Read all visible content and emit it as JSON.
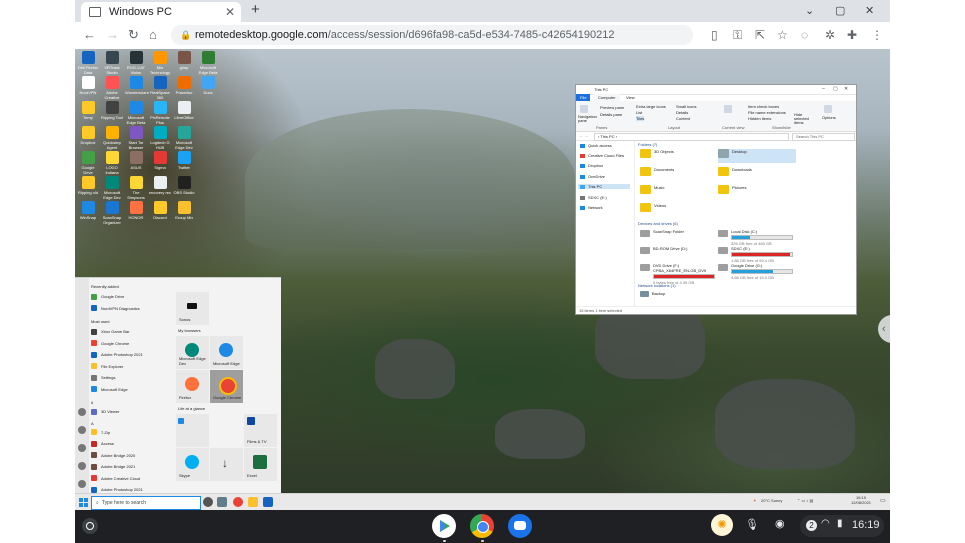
{
  "browser": {
    "tab_title": "Windows PC",
    "tab_close": "✕",
    "new_tab": "+",
    "window_controls": [
      "⌄",
      "▢",
      "✕"
    ],
    "url_host": "remotedesktop.google.com",
    "url_path": "/access/session/d696fa98-ca5d-e534-7485-c42654190212",
    "nav": {
      "back": "←",
      "forward": "→",
      "reload": "↻",
      "home": "⌂"
    },
    "right_icons": [
      "▯",
      "⚿",
      "⇱",
      "☆",
      "◌",
      "✲",
      "✚",
      "⋮"
    ]
  },
  "desktop_icons": [
    {
      "label": "Dell Firefox Data",
      "color": "#1565c0"
    },
    {
      "label": "VRTrack Studio",
      "color": "#37474f"
    },
    {
      "label": "ROG-CAT Vision",
      "color": "#263238"
    },
    {
      "label": "Mio Technology",
      "color": "#ff9800"
    },
    {
      "label": "gimp",
      "color": "#795548"
    },
    {
      "label": "Microsoft Edge Beta",
      "color": "#2e7d32"
    },
    {
      "label": "NordVPN",
      "color": "#ffffff"
    },
    {
      "label": "Adobe Creative Cloud",
      "color": "#ff5252"
    },
    {
      "label": "Wondershare",
      "color": "#1e88e5"
    },
    {
      "label": "RealSpace 360",
      "color": "#1565c0"
    },
    {
      "label": "PowerIso",
      "color": "#ef6c00"
    },
    {
      "label": "Docs",
      "color": "#42a5f5"
    },
    {
      "label": "Temp",
      "color": "#ffca28"
    },
    {
      "label": "Ripping Tool",
      "color": "#424242"
    },
    {
      "label": "Microsoft Edge Beta",
      "color": "#1e88e5"
    },
    {
      "label": "PixRemote Plus",
      "color": "#29b6f6"
    },
    {
      "label": "LibreOffice",
      "color": "#eceff1"
    },
    {
      "label": "",
      "color": "#000000"
    },
    {
      "label": "Dropbox",
      "color": "#ffca28"
    },
    {
      "label": "Quickstep Agent",
      "color": "#ffb300"
    },
    {
      "label": "Start Tor Browser",
      "color": "#7e57c2"
    },
    {
      "label": "Logitech G HUB",
      "color": "#00acc1"
    },
    {
      "label": "Microsoft Edge Dev",
      "color": "#26a69a"
    },
    {
      "label": "",
      "color": "#000000"
    },
    {
      "label": "Google Drive",
      "color": "#43a047"
    },
    {
      "label": "LOGO Indiana",
      "color": "#fdd835"
    },
    {
      "label": "ASUS",
      "color": "#8d6e63"
    },
    {
      "label": "Sigma",
      "color": "#e53935"
    },
    {
      "label": "Twitter",
      "color": "#1da1f2"
    },
    {
      "label": "",
      "color": "#000000"
    },
    {
      "label": "Ripping old",
      "color": "#ffca28"
    },
    {
      "label": "Microsoft Edge Dev",
      "color": "#00897b"
    },
    {
      "label": "The Simpsons",
      "color": "#fdd835"
    },
    {
      "label": "recovery rec",
      "color": "#eceff1"
    },
    {
      "label": "OBS Studio",
      "color": "#212121"
    },
    {
      "label": "",
      "color": "#000000"
    },
    {
      "label": "WinSnap",
      "color": "#1e88e5"
    },
    {
      "label": "ScanSnap Organizer",
      "color": "#1976d2"
    },
    {
      "label": "HONOR",
      "color": "#ff7043"
    },
    {
      "label": "Discord",
      "color": "#ffca28"
    },
    {
      "label": "Group Mix",
      "color": "#fbc02d"
    },
    {
      "label": "",
      "color": "#000000"
    }
  ],
  "start_menu": {
    "recently_added_label": "Recently added",
    "recent": [
      {
        "label": "Google Drive",
        "color": "#43a047"
      },
      {
        "label": "NordVPN Diagnostics",
        "color": "#1565c0"
      }
    ],
    "most_used_label": "Most used",
    "most_used": [
      {
        "label": "Xbox Game Bar",
        "color": "#424242"
      },
      {
        "label": "Google Chrome",
        "color": "#ea4335"
      },
      {
        "label": "Adobe Photoshop 2021",
        "color": "#1565c0"
      },
      {
        "label": "File Explorer",
        "color": "#fbc02d"
      },
      {
        "label": "Settings",
        "color": "#757575"
      },
      {
        "label": "Microsoft Edge",
        "color": "#1e88e5"
      }
    ],
    "letter_hash": "#",
    "hash_apps": [
      {
        "label": "3D Viewer",
        "color": "#5c6bc0"
      }
    ],
    "letter_a": "A",
    "a_apps": [
      {
        "label": "7-Zip",
        "color": "#fbc02d"
      },
      {
        "label": "Access",
        "color": "#c62828"
      },
      {
        "label": "Adobe Bridge 2020",
        "color": "#6d4c41"
      },
      {
        "label": "Adobe Bridge 2021",
        "color": "#6d4c41"
      },
      {
        "label": "Adobe Creative Cloud",
        "color": "#e53935"
      },
      {
        "label": "Adobe Photoshop 2021",
        "color": "#1565c0"
      }
    ],
    "tiles": {
      "sonos": "Sonos",
      "my_browsers": "My browsers",
      "edge_dev": "Microsoft Edge Dev",
      "edge": "Microsoft Edge",
      "firefox": "Firefox",
      "chrome": "Google Chrome",
      "life_at_a_glance": "Life at a glance",
      "films_tv": "Films & TV",
      "skype": "Skype",
      "excel": "Excel"
    }
  },
  "explorer": {
    "title": "This PC",
    "tabs": [
      "File",
      "Computer",
      "View"
    ],
    "ribbon": {
      "navigation_pane": "Navigation pane",
      "preview_pane": "Preview pane",
      "details_pane": "Details pane",
      "extra_large_icons": "Extra large icons",
      "large_icons": "Large icons",
      "small_icons": "Small icons",
      "list": "List",
      "details": "Details",
      "tiles": "Tiles",
      "content": "Content",
      "item_check_boxes": "Item check boxes",
      "file_name_extensions": "File name extensions",
      "hidden_items": "Hidden items",
      "hide_selected": "Hide selected items",
      "options": "Options",
      "groups": [
        "Panes",
        "Layout",
        "Current view",
        "Show/hide"
      ]
    },
    "address": "›  This PC  ›",
    "search_placeholder": "Search This PC",
    "nav_items": [
      {
        "label": "Quick access",
        "color": "#1e88e5"
      },
      {
        "label": "Creative Cloud Files",
        "color": "#e53935"
      },
      {
        "label": "Dropbox",
        "color": "#1e88e5"
      },
      {
        "label": "OneDrive",
        "color": "#1e88e5"
      },
      {
        "label": "This PC",
        "color": "#42a5f5"
      },
      {
        "label": "SDXC (E:)",
        "color": "#757575"
      },
      {
        "label": "Network",
        "color": "#1e88e5"
      }
    ],
    "folders_header": "Folders (7)",
    "folders": [
      "3D Objects",
      "Desktop",
      "Documents",
      "Downloads",
      "Music",
      "Pictures",
      "Videos"
    ],
    "devices_header": "Devices and drives (6)",
    "drives": [
      {
        "name": "ScanSnap Folder",
        "sub": "",
        "fill": 0
      },
      {
        "name": "Local Disk (C:)",
        "sub": "326 GB free of 465 GB",
        "fill": 0.3
      },
      {
        "name": "BD-ROM Drive (D:)",
        "sub": "",
        "fill": 0
      },
      {
        "name": "SDXC (E:)",
        "sub": "1.88 GB free of 59.4 GB",
        "fill": 0.97
      },
      {
        "name": "DVD Drive (F:) CPBA_X64FRE_EN-GB_DV9",
        "sub": "0 bytes free of 4.39 GB",
        "fill": 1
      },
      {
        "name": "Google Drive (G:)",
        "sub": "4.66 GB free of 15.0 GB",
        "fill": 0.69
      }
    ],
    "network_header": "Network locations (1)",
    "network": [
      "Backup"
    ],
    "status": "15 items    1 item selected"
  },
  "windows_taskbar": {
    "search_placeholder": "Type here to search",
    "weather": "20°C  Sunny",
    "time": "16:19",
    "date": "12/08/2021"
  },
  "chromeos_shelf": {
    "apps": [
      {
        "name": "Play Store",
        "color": "#34a853"
      },
      {
        "name": "Google Chrome",
        "color": "#ea4335"
      },
      {
        "name": "Messages",
        "color": "#1a73e8"
      }
    ],
    "notifications": "2",
    "time": "16:19"
  }
}
